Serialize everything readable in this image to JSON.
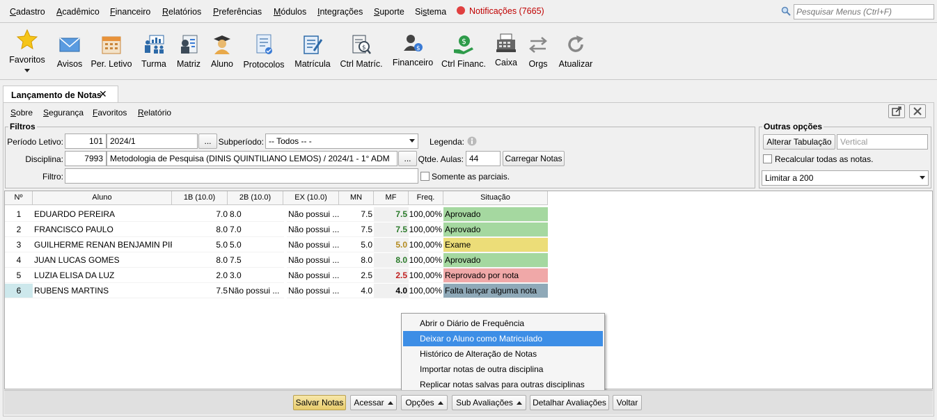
{
  "menubar": {
    "items": [
      {
        "pre": "",
        "u": "C",
        "post": "adastro"
      },
      {
        "pre": "",
        "u": "A",
        "post": "cadêmico"
      },
      {
        "pre": "",
        "u": "F",
        "post": "inanceiro"
      },
      {
        "pre": "",
        "u": "R",
        "post": "elatórios"
      },
      {
        "pre": "",
        "u": "P",
        "post": "referências"
      },
      {
        "pre": "",
        "u": "M",
        "post": "ódulos"
      },
      {
        "pre": "",
        "u": "I",
        "post": "ntegrações"
      },
      {
        "pre": "",
        "u": "S",
        "post": "uporte"
      },
      {
        "pre": "Si",
        "u": "s",
        "post": "tema"
      }
    ],
    "notifications": "Notificações (7665)",
    "search_placeholder": "Pesquisar Menus (Ctrl+F)"
  },
  "toolbar": {
    "items": [
      "Favoritos",
      "Avisos",
      "Per. Letivo",
      "Turma",
      "Matriz",
      "Aluno",
      "Protocolos",
      "Matrícula",
      "Ctrl Matríc.",
      "Financeiro",
      "Ctrl Financ.",
      "Caixa",
      "Orgs",
      "Atualizar"
    ]
  },
  "tab": {
    "label": "Lançamento de Notas",
    "close": "✕"
  },
  "submenu": {
    "items": [
      {
        "u": "S",
        "post": "obre"
      },
      {
        "u": "S",
        "post": "egurança"
      },
      {
        "u": "F",
        "post": "avoritos"
      },
      {
        "u": "R",
        "post": "elatório"
      }
    ]
  },
  "filters": {
    "legend": "Filtros",
    "periodo_label": "Período Letivo:",
    "periodo_code": "101",
    "periodo_value": "2024/1",
    "subperiodo_label": "Subperíodo:",
    "subperiodo_value": "-- Todos -- -",
    "legenda_label": "Legenda:",
    "disciplina_label": "Disciplina:",
    "disciplina_code": "7993",
    "disciplina_value": "Metodologia de Pesquisa (DINIS QUINTILIANO LEMOS) / 2024/1 - 1° ADM",
    "browse": "...",
    "qtde_label": "Qtde. Aulas:",
    "qtde_value": "44",
    "carregar": "Carregar Notas",
    "filtro_label": "Filtro:",
    "somente": "Somente as parciais."
  },
  "outras": {
    "legend": "Outras opções",
    "alterar": "Alterar Tabulação",
    "vertical": "Vertical",
    "recalcular": "Recalcular todas as notas.",
    "limitar": "Limitar a 200"
  },
  "grid": {
    "headers": [
      "Nº",
      "Aluno",
      "1B (10.0)",
      "2B (10.0)",
      "EX (10.0)",
      "MN",
      "MF",
      "Freq.",
      "Situação"
    ],
    "rows": [
      {
        "n": "1",
        "aluno": "EDUARDO PEREIRA",
        "b1": "7.0",
        "b2": "8.0",
        "ex": "Não possui ...",
        "mn": "7.5",
        "mf": "7.5",
        "freq": "100,00%",
        "sit": "Aprovado"
      },
      {
        "n": "2",
        "aluno": "FRANCISCO PAULO",
        "b1": "8.0",
        "b2": "7.0",
        "ex": "Não possui ...",
        "mn": "7.5",
        "mf": "7.5",
        "freq": "100,00%",
        "sit": "Aprovado"
      },
      {
        "n": "3",
        "aluno": "GUILHERME RENAN BENJAMIN PIR...",
        "b1": "5.0",
        "b2": "5.0",
        "ex": "Não possui ...",
        "mn": "5.0",
        "mf": "5.0",
        "freq": "100,00%",
        "sit": "Exame"
      },
      {
        "n": "4",
        "aluno": "JUAN LUCAS GOMES",
        "b1": "8.0",
        "b2": "7.5",
        "ex": "Não possui ...",
        "mn": "8.0",
        "mf": "8.0",
        "freq": "100,00%",
        "sit": "Aprovado"
      },
      {
        "n": "5",
        "aluno": "LUZIA ELISA DA LUZ",
        "b1": "2.0",
        "b2": "3.0",
        "ex": "Não possui ...",
        "mn": "2.5",
        "mf": "2.5",
        "freq": "100,00%",
        "sit": "Reprovado por nota"
      },
      {
        "n": "6",
        "aluno": "RUBENS MARTINS",
        "b1": "7.5",
        "b2": "Não possui ...",
        "ex": "Não possui ...",
        "mn": "4.0",
        "mf": "4.0",
        "freq": "100,00%",
        "sit": "Falta lançar alguma nota"
      }
    ],
    "colors": {
      "aprovado": "#a5d8a0",
      "exame": "#ecdd78",
      "reprovado": "#f0a8a8",
      "falta": "#8fa9b8",
      "mf_green": "#2a7a2a",
      "mf_gold": "#b38a1e",
      "mf_red": "#c02020"
    }
  },
  "context_menu": {
    "items": [
      "Abrir o Diário de Frequência",
      "Deixar o Aluno como Matriculado",
      "Histórico de Alteração de Notas",
      "Importar notas de outra disciplina",
      "Replicar notas salvas para outras disciplinas"
    ]
  },
  "bottom": {
    "salvar": "Salvar Notas",
    "acessar": "Acessar",
    "opcoes": "Opções",
    "sub": "Sub Avaliações",
    "detalhar": "Detalhar Avaliações",
    "voltar": "Voltar"
  }
}
